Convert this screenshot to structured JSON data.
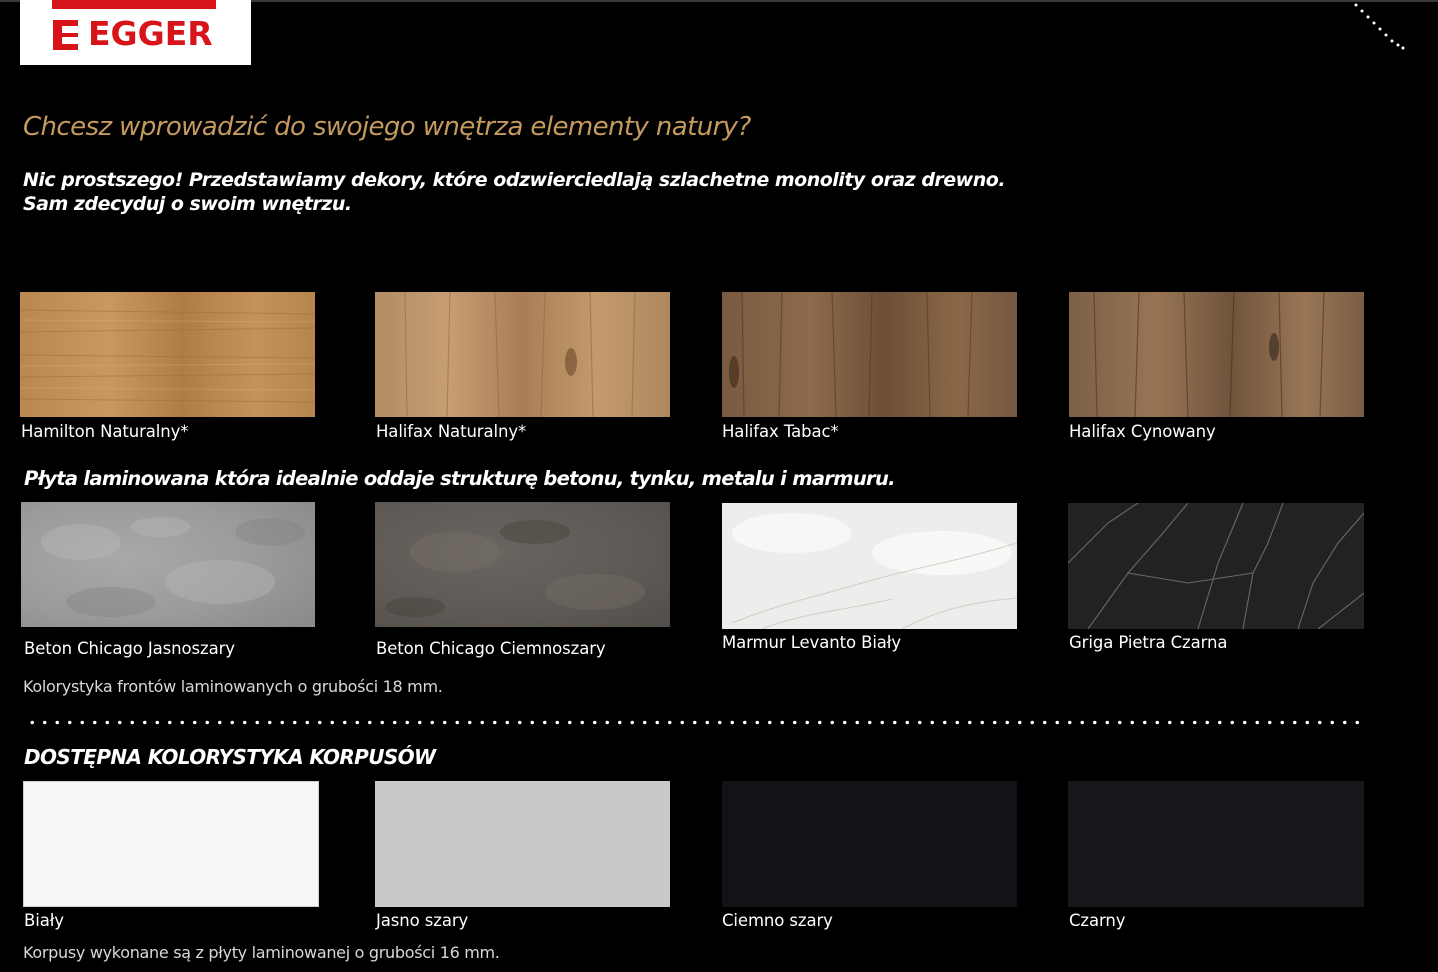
{
  "brand": {
    "logo_text": "EGGER",
    "logo_letter": "E",
    "red": "#d7141a",
    "gold": "#c59a5e"
  },
  "headline": "Chcesz wprowadzić do swojego wnętrza elementy natury?",
  "intro": {
    "line1": "Nic prostszego! Przedstawiamy dekory, które odzwierciedlają szlachetne monolity oraz drewno.",
    "line2": "Sam zdecyduj o swoim wnętrzu."
  },
  "wood": {
    "items": [
      {
        "label": "Hamilton Naturalny*",
        "icon": "wood-texture"
      },
      {
        "label": "Halifax Naturalny*",
        "icon": "wood-texture"
      },
      {
        "label": "Halifax Tabac*",
        "icon": "wood-texture"
      },
      {
        "label": "Halifax Cynowany",
        "icon": "wood-texture"
      }
    ]
  },
  "stone": {
    "heading": "Płyta laminowana która idealnie oddaje strukturę betonu, tynku, metalu i marmuru.",
    "items": [
      {
        "label": "Beton Chicago Jasnoszary",
        "icon": "concrete-texture"
      },
      {
        "label": "Beton Chicago Ciemnoszary",
        "icon": "concrete-texture"
      },
      {
        "label": "Marmur Levanto Biały",
        "icon": "marble-texture"
      },
      {
        "label": "Griga Pietra Czarna",
        "icon": "marble-texture"
      }
    ],
    "note": "Kolorystyka frontów laminowanych o grubości 18 mm."
  },
  "korpus": {
    "heading": "DOSTĘPNA KOLORYSTYKA KORPUSÓW",
    "items": [
      {
        "label": "Biały",
        "color": "#f7f7f7"
      },
      {
        "label": "Jasno szary",
        "color": "#c9c8cb"
      },
      {
        "label": "Ciemno szary",
        "color": "#121316"
      },
      {
        "label": "Czarny",
        "color": "#16171b"
      }
    ],
    "note": "Korpusy wykonane są  z płyty laminowanej o grubości  16 mm."
  }
}
